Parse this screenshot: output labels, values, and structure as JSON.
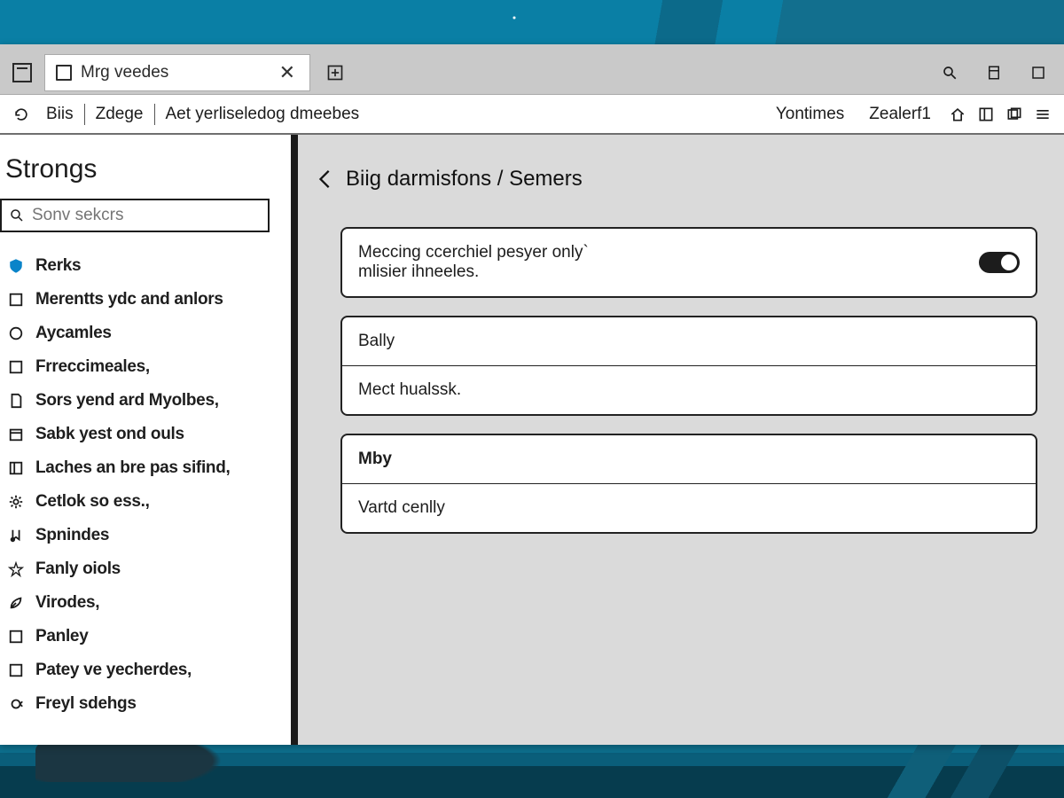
{
  "tab": {
    "title": "Mrg veedes"
  },
  "menubar": {
    "crumbs": [
      "Biis",
      "Zdege",
      "Aet yerliseledog dmeebes"
    ],
    "right": [
      "Yontimes",
      "Zealerf1"
    ]
  },
  "sidebar": {
    "title": "Strongs",
    "search_placeholder": "Sonv sekcrs",
    "items": [
      {
        "label": "Rerks",
        "icon": "shield"
      },
      {
        "label": "Merentts ydc and anlors",
        "icon": "square"
      },
      {
        "label": "Aycamles",
        "icon": "circle"
      },
      {
        "label": "Frreccimeales,",
        "icon": "square"
      },
      {
        "label": "Sors yend ard Myolbes,",
        "icon": "page"
      },
      {
        "label": "Sabk yest ond ouls",
        "icon": "calendar"
      },
      {
        "label": "Laches an bre pas sifind,",
        "icon": "panel"
      },
      {
        "label": "Cetlok so ess.,",
        "icon": "gear"
      },
      {
        "label": "Spnindes",
        "icon": "note"
      },
      {
        "label": "Fanly oiols",
        "icon": "star"
      },
      {
        "label": "Virodes,",
        "icon": "leaf"
      },
      {
        "label": "Panley",
        "icon": "square"
      },
      {
        "label": "Patey ve yecherdes,",
        "icon": "square"
      },
      {
        "label": "Freyl sdehgs",
        "icon": "loop"
      }
    ]
  },
  "content": {
    "heading": "Biig darmisfons / Semers",
    "card1": {
      "line1": "Meccing ccerchiel pesyer only`",
      "line2": "mlisier ihneeles."
    },
    "card2": {
      "row1": "Bally",
      "row2": "Mect hualssk."
    },
    "card3": {
      "head": "Mby",
      "row": "Vartd cenlly"
    }
  }
}
